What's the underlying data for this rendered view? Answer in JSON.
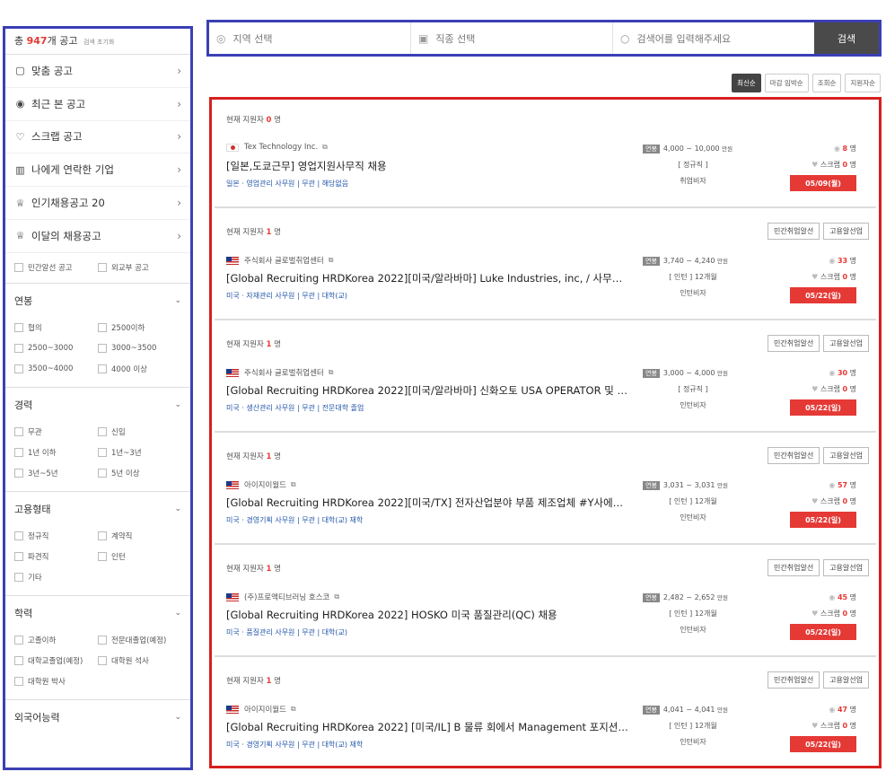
{
  "sidebar": {
    "total_prefix": "총 ",
    "total_count": "947",
    "total_suffix": "개 공고",
    "reset_label": "검색 초기화",
    "menu": [
      {
        "label": "맞춤 공고",
        "icon": "document-icon",
        "glyph": "▢"
      },
      {
        "label": "최근 본 공고",
        "icon": "eye-icon",
        "glyph": "◉"
      },
      {
        "label": "스크랩 공고",
        "icon": "heart-icon",
        "glyph": "♡"
      },
      {
        "label": "나에게 연락한 기업",
        "icon": "building-icon",
        "glyph": "▥"
      },
      {
        "label": "인기채용공고 20",
        "icon": "trophy-icon",
        "glyph": "♕"
      },
      {
        "label": "이달의 채용공고",
        "icon": "trophy-icon",
        "glyph": "♕"
      }
    ],
    "extra_checks": [
      "민간알선 공고",
      "외교부 공고"
    ],
    "sections": [
      {
        "title": "연봉",
        "options": [
          "협의",
          "2500이하",
          "2500~3000",
          "3000~3500",
          "3500~4000",
          "4000 이상"
        ]
      },
      {
        "title": "경력",
        "options": [
          "무관",
          "신입",
          "1년 이하",
          "1년~3년",
          "3년~5년",
          "5년 이상"
        ]
      },
      {
        "title": "고용형태",
        "options": [
          "정규직",
          "계약직",
          "파견직",
          "인턴",
          "기타"
        ]
      },
      {
        "title": "학력",
        "options": [
          "고졸이하",
          "전문대졸업(예정)",
          "대학교졸업(예정)",
          "대학원 석사",
          "대학원 박사"
        ]
      },
      {
        "title": "외국어능력",
        "options": []
      }
    ]
  },
  "search": {
    "region_placeholder": "지역 선택",
    "job_placeholder": "직종 선택",
    "keyword_placeholder": "검색어를 입력해주세요",
    "button_label": "검색"
  },
  "sorts": [
    "최신순",
    "마감 임박순",
    "조회순",
    "지원자순"
  ],
  "jobs": [
    {
      "applicants_prefix": "현재 지원자 ",
      "applicants": "0",
      "applicants_suffix": " 명",
      "tags": [],
      "flag": "jp",
      "company": "Tex Technology Inc.",
      "title": "[일본,도쿄근무] 영업지원사무직 채용",
      "meta": "일본 · 영업관리 사무원 | 무관 | 해당없음",
      "salary_label": "연봉",
      "salary": "4,000 ~ 10,000",
      "salary_unit": "만원",
      "employment": "[ 정규직 ]",
      "visa": "취업비자",
      "views": "8",
      "views_unit": " 명",
      "scrap_label": " 스크랩 ",
      "scraps": "0",
      "scrap_unit": " 명",
      "deadline": "05/09(월)"
    },
    {
      "applicants_prefix": "현재 지원자 ",
      "applicants": "1",
      "applicants_suffix": " 명",
      "tags": [
        "민간취업알선",
        "고용알선업"
      ],
      "flag": "us",
      "company": "주식회사 글로벌취업센터",
      "title": "[Global Recruiting HRDKorea 2022][미국/알라바마] Luke Industries, inc, / 사무직(…",
      "meta": "미국 · 자재관리 사무원 | 무관 | 대학(교)",
      "salary_label": "연봉",
      "salary": "3,740 ~ 4,240",
      "salary_unit": "만원",
      "employment": "[ 인턴 ] 12개월",
      "visa": "인턴비자",
      "views": "33",
      "views_unit": " 명",
      "scrap_label": " 스크랩 ",
      "scraps": "0",
      "scrap_unit": " 명",
      "deadline": "05/22(일)"
    },
    {
      "applicants_prefix": "현재 지원자 ",
      "applicants": "1",
      "applicants_suffix": " 명",
      "tags": [
        "민간취업알선",
        "고용알선업"
      ],
      "flag": "us",
      "company": "주식회사 글로벌취업센터",
      "title": "[Global Recruiting HRDKorea 2022][미국/알라바마] 신화오토 USA OPERATOR 및 …",
      "meta": "미국 · 생산관리 사무원 | 무관 | 전문대학 졸업",
      "salary_label": "연봉",
      "salary": "3,000 ~ 4,000",
      "salary_unit": "만원",
      "employment": "[ 정규직 ]",
      "visa": "인턴비자",
      "views": "30",
      "views_unit": " 명",
      "scrap_label": " 스크랩 ",
      "scraps": "0",
      "scrap_unit": " 명",
      "deadline": "05/22(일)"
    },
    {
      "applicants_prefix": "현재 지원자 ",
      "applicants": "1",
      "applicants_suffix": " 명",
      "tags": [
        "민간취업알선",
        "고용알선업"
      ],
      "flag": "us",
      "company": "아이지이월드",
      "title": "[Global Recruiting HRDKorea 2022][미국/TX] 전자산업분야 부품 제조업체 #Y사에…",
      "meta": "미국 · 경영기획 사무원 | 무관 | 대학(교) 재학",
      "salary_label": "연봉",
      "salary": "3,031 ~ 3,031",
      "salary_unit": "만원",
      "employment": "[ 인턴 ] 12개월",
      "visa": "인턴비자",
      "views": "57",
      "views_unit": " 명",
      "scrap_label": " 스크랩 ",
      "scraps": "0",
      "scrap_unit": " 명",
      "deadline": "05/22(일)"
    },
    {
      "applicants_prefix": "현재 지원자 ",
      "applicants": "1",
      "applicants_suffix": " 명",
      "tags": [
        "민간취업알선",
        "고용알선업"
      ],
      "flag": "us",
      "company": "(주)프로액티브러닝 호스코",
      "title": "[Global Recruiting HRDKorea 2022] HOSKO 미국 품질관리(QC) 채용",
      "meta": "미국 · 품질관리 사무원 | 무관 | 대학(교)",
      "salary_label": "연봉",
      "salary": "2,482 ~ 2,652",
      "salary_unit": "만원",
      "employment": "[ 인턴 ] 12개월",
      "visa": "인턴비자",
      "views": "45",
      "views_unit": " 명",
      "scrap_label": " 스크랩 ",
      "scraps": "0",
      "scrap_unit": " 명",
      "deadline": "05/22(일)"
    },
    {
      "applicants_prefix": "현재 지원자 ",
      "applicants": "1",
      "applicants_suffix": " 명",
      "tags": [
        "민간취업알선",
        "고용알선업"
      ],
      "flag": "us",
      "company": "아이지이월드",
      "title": "[Global Recruiting HRDKorea 2022] [미국/IL] B 물류 회에서 Management 포지션…",
      "meta": "미국 · 경영기획 사무원 | 무관 | 대학(교) 재학",
      "salary_label": "연봉",
      "salary": "4,041 ~ 4,041",
      "salary_unit": "만원",
      "employment": "[ 인턴 ] 12개월",
      "visa": "인턴비자",
      "views": "47",
      "views_unit": " 명",
      "scrap_label": " 스크랩 ",
      "scraps": "0",
      "scrap_unit": " 명",
      "deadline": "05/22(일)"
    }
  ]
}
